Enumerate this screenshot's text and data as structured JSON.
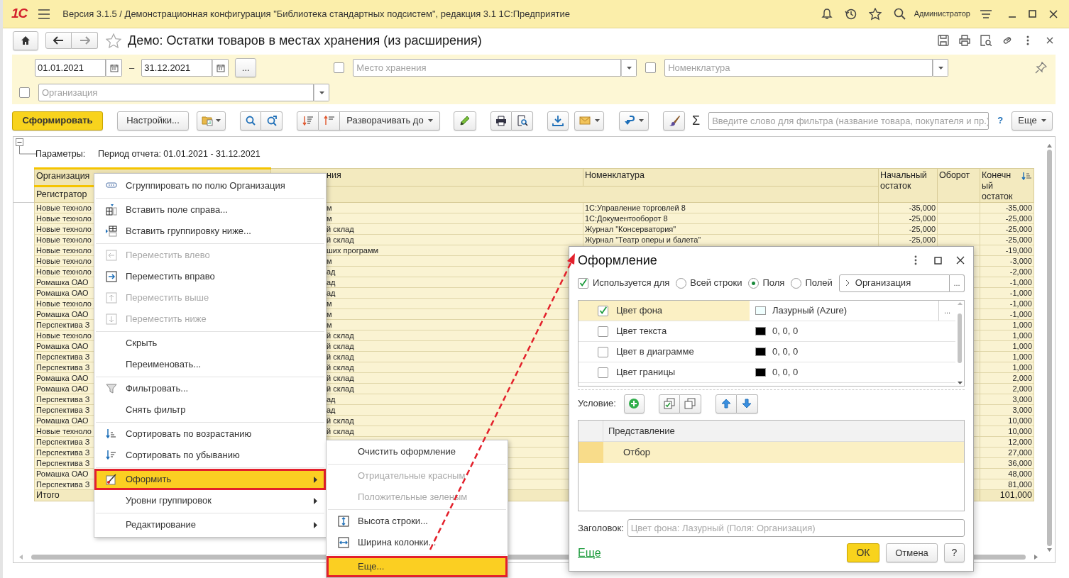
{
  "window": {
    "logo": "1С",
    "title": "Версия 3.1.5 / Демонстрационная конфигурация \"Библиотека стандартных подсистем\", редакция 3.1 1С:Предприятие",
    "user": "Администратор"
  },
  "form": {
    "title": "Демо: Остатки товаров в местах хранения (из расширения)",
    "favorite": false
  },
  "filters": {
    "date_from": "01.01.2021",
    "dash": "–",
    "date_to": "31.12.2021",
    "period_button": "...",
    "fields": [
      {
        "placeholder": "Место хранения",
        "checked": false
      },
      {
        "placeholder": "Номенклатура",
        "checked": false
      },
      {
        "placeholder": "Организация",
        "checked": false
      }
    ]
  },
  "command_bar": {
    "generate": "Сформировать",
    "settings": "Настройки...",
    "expand": "Разворачивать до",
    "sum": "Σ",
    "search": {
      "placeholder": "Введите слово для фильтра (название товара, покупателя и пр.)"
    },
    "help": "?",
    "more": "Еще"
  },
  "report": {
    "params_label": "Параметры:",
    "params_value": "Период отчета: 01.01.2021 - 31.12.2021",
    "columns": [
      {
        "label": "Организация",
        "selected": true,
        "sorted": false
      },
      {
        "label": "ния",
        "selected": false,
        "sorted": false
      },
      {
        "label": "Номенклатура",
        "selected": false,
        "sorted": false
      },
      {
        "label": "Начальный остаток",
        "selected": false,
        "sorted": false
      },
      {
        "label": "Оборот",
        "selected": false,
        "sorted": false
      },
      {
        "label": "Конечный остаток",
        "selected": false,
        "sorted": true
      }
    ],
    "subheader": "Регистратор",
    "rows": [
      {
        "organization": "Новые техноло",
        "column_2": "м",
        "nomenclature": "1С:Управление торговлей 8",
        "opening": "-35,000",
        "closing": "-35,000"
      },
      {
        "organization": "Новые техноло",
        "column_2": "м",
        "nomenclature": "1С:Документооборот 8",
        "opening": "-25,000",
        "closing": "-25,000"
      },
      {
        "organization": "Новые техноло",
        "column_2": "й склад",
        "nomenclature": "Журнал \"Консерватория\"",
        "opening": "-25,000",
        "closing": "-25,000"
      },
      {
        "organization": "Новые техноло",
        "column_2": "й склад",
        "nomenclature": "Журнал \"Театр оперы и балета\"",
        "opening": "-25,000",
        "closing": "-25,000"
      },
      {
        "organization": "Новые техноло",
        "column_2": "ших программ",
        "closing": "-19,000"
      },
      {
        "organization": "Новые техноло",
        "column_2": "м",
        "closing": "-3,000"
      },
      {
        "organization": "Новые техноло",
        "column_2": "ад",
        "closing": "-2,000"
      },
      {
        "organization": "Ромашка ОАО",
        "column_2": "ад",
        "closing": "-1,000"
      },
      {
        "organization": "Ромашка ОАО",
        "column_2": "ад",
        "closing": "-1,000"
      },
      {
        "organization": "Новые техноло",
        "column_2": "м",
        "closing": "-1,000"
      },
      {
        "organization": "Ромашка ОАО",
        "column_2": "м",
        "closing": "-1,000"
      },
      {
        "organization": "Перспектива З",
        "column_2": "м",
        "closing": "1,000"
      },
      {
        "organization": "Новые техноло",
        "column_2": "й склад",
        "closing": "1,000"
      },
      {
        "organization": "Ромашка ОАО",
        "column_2": "й склад",
        "closing": "1,000"
      },
      {
        "organization": "Перспектива З",
        "column_2": "й склад",
        "closing": "1,000"
      },
      {
        "organization": "Перспектива З",
        "column_2": "й склад",
        "closing": "1,000"
      },
      {
        "organization": "Ромашка ОАО",
        "column_2": "й склад",
        "closing": "2,000"
      },
      {
        "organization": "Ромашка ОАО",
        "column_2": "й склад",
        "closing": "2,000"
      },
      {
        "organization": "Перспектива З",
        "column_2": "ад",
        "closing": "3,000"
      },
      {
        "organization": "Перспектива З",
        "column_2": "ад",
        "closing": "3,000"
      },
      {
        "organization": "Ромашка ОАО",
        "column_2": "й склад",
        "closing": "10,000"
      },
      {
        "organization": "Новые техноло",
        "column_2": "й склад",
        "closing": "10,000"
      },
      {
        "organization": "Перспектива З",
        "closing": "12,000"
      },
      {
        "organization": "Перспектива З",
        "closing": "27,000"
      },
      {
        "organization": "Перспектива З",
        "closing": "36,000"
      },
      {
        "organization": "Ромашка ОАО",
        "closing": "48,000"
      },
      {
        "organization": "Перспектива З",
        "closing": "81,000"
      }
    ],
    "total": {
      "label": "Итого",
      "closing": "101,000"
    }
  },
  "context_menu": {
    "groups": [
      [
        {
          "label": "Сгруппировать по полю Организация",
          "disabled": false,
          "selected": false,
          "submenu": false
        }
      ],
      [
        {
          "label": "Вставить поле справа...",
          "disabled": false,
          "selected": false,
          "submenu": false
        },
        {
          "label": "Вставить группировку ниже...",
          "disabled": false,
          "selected": false,
          "submenu": false
        }
      ],
      [
        {
          "label": "Переместить влево",
          "disabled": true,
          "selected": false,
          "submenu": false
        },
        {
          "label": "Переместить вправо",
          "disabled": false,
          "selected": false,
          "submenu": false
        },
        {
          "label": "Переместить выше",
          "disabled": true,
          "selected": false,
          "submenu": false
        },
        {
          "label": "Переместить ниже",
          "disabled": true,
          "selected": false,
          "submenu": false
        }
      ],
      [
        {
          "label": "Скрыть",
          "disabled": false,
          "selected": false,
          "submenu": false
        },
        {
          "label": "Переименовать...",
          "disabled": false,
          "selected": false,
          "submenu": false
        }
      ],
      [
        {
          "label": "Фильтровать...",
          "disabled": false,
          "selected": false,
          "submenu": false
        },
        {
          "label": "Снять фильтр",
          "disabled": false,
          "selected": false,
          "submenu": false
        }
      ],
      [
        {
          "label": "Сортировать по возрастанию",
          "disabled": false,
          "selected": false,
          "submenu": false
        },
        {
          "label": "Сортировать по убыванию",
          "disabled": false,
          "selected": false,
          "submenu": false
        }
      ],
      [
        {
          "label": "Оформить",
          "disabled": false,
          "selected": true,
          "submenu": true
        },
        {
          "label": "Уровни группировок",
          "disabled": false,
          "selected": false,
          "submenu": true
        }
      ],
      [
        {
          "label": "Редактирование",
          "disabled": false,
          "selected": false,
          "submenu": true
        }
      ]
    ]
  },
  "submenu": {
    "groups": [
      [
        {
          "label": "Очистить оформление",
          "disabled": false,
          "selected": false
        }
      ],
      [
        {
          "label": "Отрицательные красным",
          "disabled": true,
          "selected": false
        },
        {
          "label": "Положительные зеленым",
          "disabled": true,
          "selected": false
        }
      ],
      [
        {
          "label": "Высота строки...",
          "disabled": false,
          "selected": false
        },
        {
          "label": "Ширина колонки...",
          "disabled": false,
          "selected": false
        }
      ],
      [
        {
          "label": "Еще...",
          "disabled": false,
          "selected": true
        }
      ]
    ]
  },
  "dialog": {
    "title": "Оформление",
    "use_for": {
      "label": "Используется для",
      "checked": true
    },
    "scope": [
      {
        "label": "Всей строки",
        "selected": false
      },
      {
        "label": "Поля",
        "selected": true
      },
      {
        "label": "Полей",
        "selected": false
      }
    ],
    "field": "Организация",
    "field_button": "...",
    "properties": [
      {
        "label": "Цвет фона",
        "checked": true,
        "selected": true,
        "value": "Лазурный (Azure)",
        "color": "#f0ffff"
      },
      {
        "label": "Цвет текста",
        "checked": false,
        "selected": false,
        "value": "0, 0, 0",
        "color": "#000000"
      },
      {
        "label": "Цвет в диаграмме",
        "checked": false,
        "selected": false,
        "value": "0, 0, 0",
        "color": "#000000"
      },
      {
        "label": "Цвет границы",
        "checked": false,
        "selected": false,
        "value": "0, 0, 0",
        "color": "#000000"
      }
    ],
    "value_button": "...",
    "condition_label": "Условие:",
    "conditions": {
      "column": "Представление",
      "rows": [
        {
          "label": "Отбор",
          "selected": true
        }
      ]
    },
    "caption_label": "Заголовок:",
    "caption_placeholder": "Цвет фона: Лазурный (Поля: Организация)",
    "more_link": "Еще",
    "ok": "ОК",
    "cancel": "Отмена",
    "help": "?"
  }
}
